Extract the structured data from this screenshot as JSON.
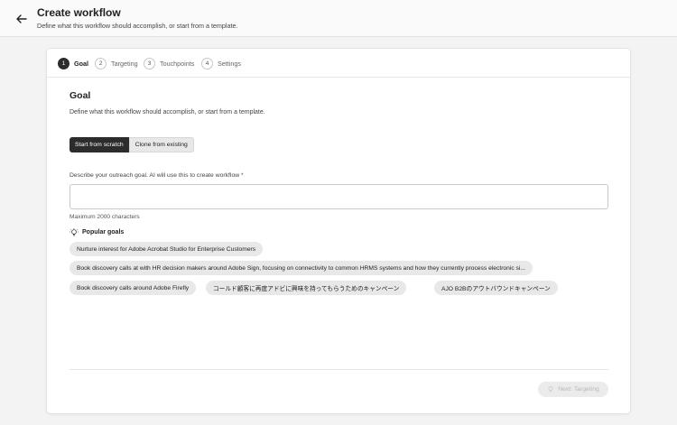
{
  "header": {
    "title": "Create workflow",
    "subtitle": "Define what this workflow should accomplish, or start from a template.",
    "back_icon": "arrow-left-icon"
  },
  "stepper": {
    "steps": [
      {
        "number": "1",
        "label": "Goal",
        "active": true
      },
      {
        "number": "2",
        "label": "Targeting",
        "active": false
      },
      {
        "number": "3",
        "label": "Touchpoints",
        "active": false
      },
      {
        "number": "4",
        "label": "Settings",
        "active": false
      }
    ]
  },
  "goal": {
    "title": "Goal",
    "subtitle": "Define what this workflow should accomplish, or start from a template.",
    "toggle": {
      "option_1": "Start from scratch",
      "option_2": "Clone from existing",
      "selected": "Start from scratch"
    },
    "field_label": "Describe your outreach goal. AI will use this to create workflow *",
    "field_value": "",
    "helper_text": "Maximum 2000 characters",
    "popular_label": "Popular goals",
    "popular_icon": "lightbulb-icon",
    "chips": [
      "Nurture interest for Adobe Acrobat Studio for Enterprise Customers",
      "Book discovery calls at with HR decision makers around Adobe Sign, focusing on connectivity to common HRMS systems and how they currently process electronic si...",
      "Book discovery calls around Adobe Firefly",
      "コールド顧客に再度アドビに興味を持ってもらうためのキャンペーン",
      "AJO B2Bのアウトバウンドキャンペーン"
    ]
  },
  "footer": {
    "next_label": "Next: Targeting",
    "next_disabled": true,
    "next_icon": "lightbulb-icon"
  },
  "colors": {
    "active": "#2c2c2c",
    "chip_bg": "#e8e8e8",
    "page_bg": "#f3f3f3"
  }
}
